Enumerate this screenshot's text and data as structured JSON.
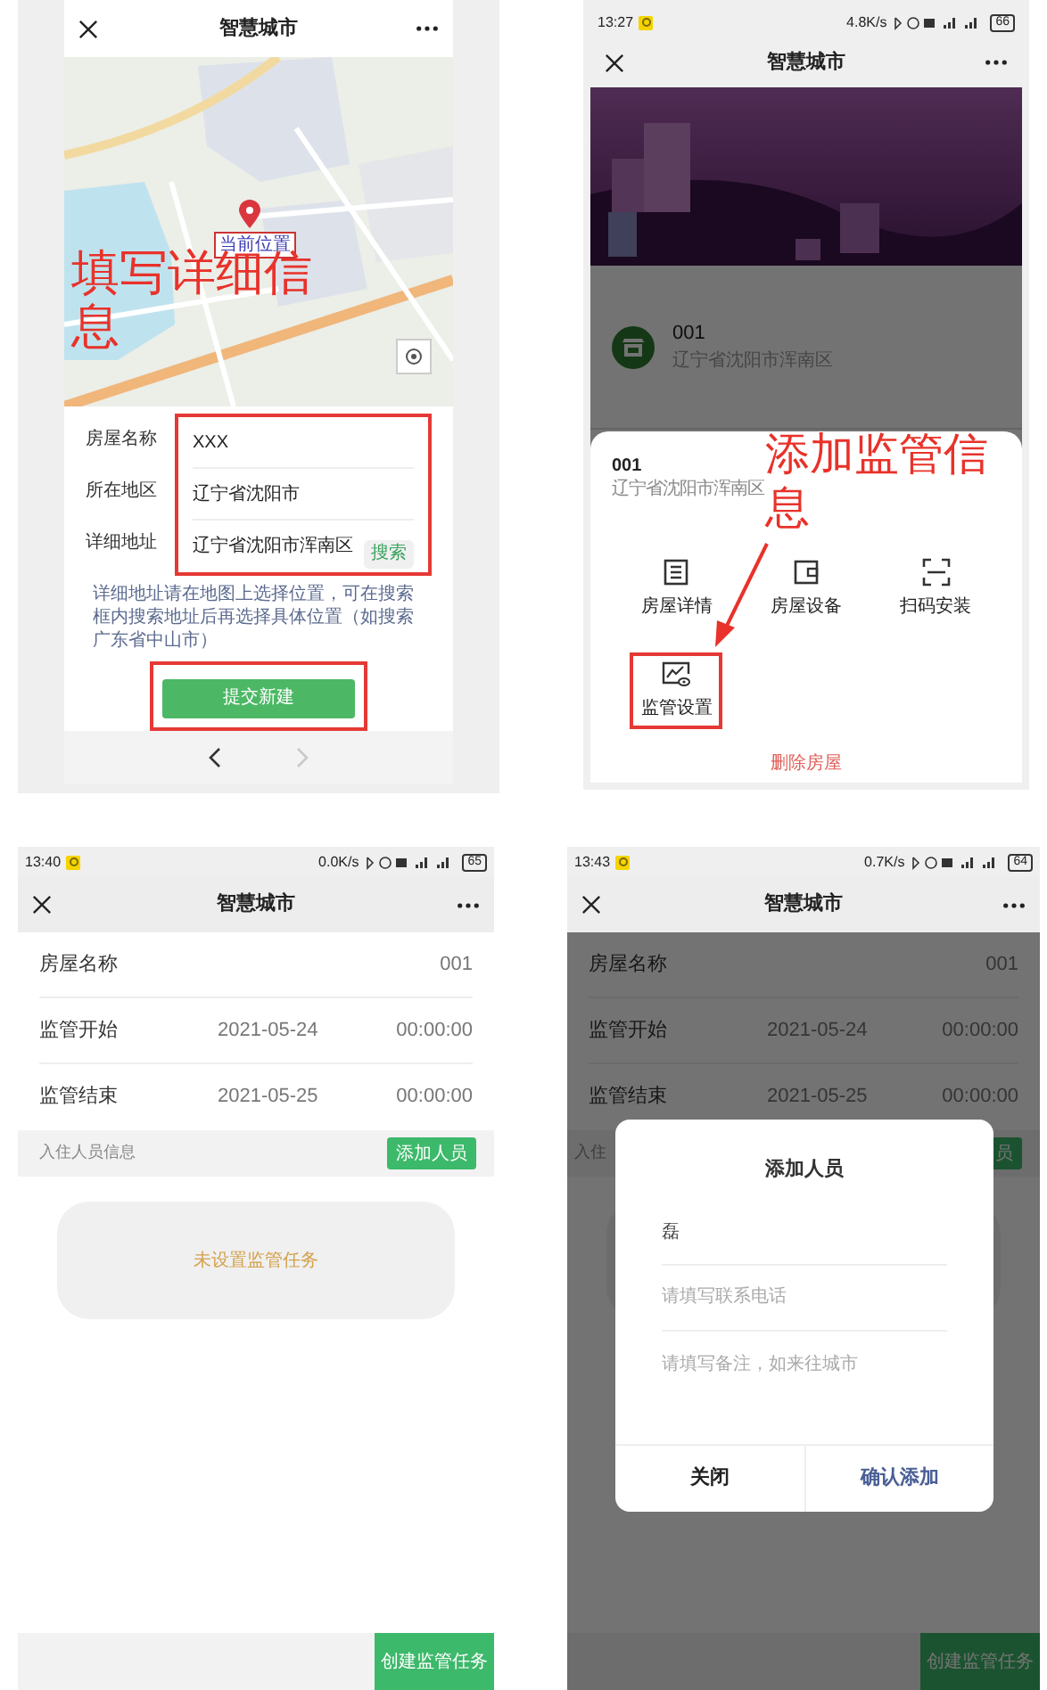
{
  "create_house": {
    "title": "智慧城市",
    "map": {
      "marker_label": "当前位置"
    },
    "annotation": "填写详细信息",
    "fields_highlighted": true,
    "fields": [
      {
        "label": "房屋名称",
        "value": "XXX"
      },
      {
        "label": "所在地区",
        "value": "辽宁省沈阳市"
      },
      {
        "label": "详细地址",
        "value": "辽宁省沈阳市浑南区",
        "action": "搜索"
      }
    ],
    "hint": "详细地址请在地图上选择位置，可在搜索框内搜索地址后再选择具体位置（如搜索广东省中山市）",
    "submit": {
      "label": "提交新建",
      "highlighted": true
    },
    "browser_nav": [
      {
        "kind": "back",
        "disabled": false
      },
      {
        "kind": "forward",
        "disabled": true
      }
    ]
  },
  "house_menu": {
    "status": {
      "time": "13:27",
      "speed": "4.8K/s",
      "battery": "66"
    },
    "title": "智慧城市",
    "house": {
      "name": "001",
      "address": "辽宁省沈阳市浑南区"
    },
    "sheet": {
      "name": "001",
      "address": "辽宁省沈阳市浑南区",
      "actions": [
        {
          "kind": "list",
          "label": "房屋详情",
          "highlighted": false
        },
        {
          "kind": "device",
          "label": "房屋设备",
          "highlighted": false
        },
        {
          "kind": "scan",
          "label": "扫码安装",
          "highlighted": false
        },
        {
          "kind": "monitor",
          "label": "监管设置",
          "highlighted": true
        }
      ],
      "delete": "删除房屋"
    },
    "annotation": "添加监管信息"
  },
  "supervision": {
    "status": {
      "time": "13:40",
      "speed": "0.0K/s",
      "battery": "65"
    },
    "title": "智慧城市",
    "rows": [
      {
        "label": "房屋名称",
        "value": "001"
      },
      {
        "label": "监管开始",
        "date": "2021-05-24",
        "time": "00:00:00"
      },
      {
        "label": "监管结束",
        "date": "2021-05-25",
        "time": "00:00:00"
      }
    ],
    "residents": {
      "label": "入住人员信息",
      "button": "添加人员"
    },
    "empty": "未设置监管任务",
    "create_button": "创建监管任务"
  },
  "add_person": {
    "status": {
      "time": "13:43",
      "speed": "0.7K/s",
      "battery": "64"
    },
    "title": "智慧城市",
    "rows": [
      {
        "label": "房屋名称",
        "value": "001"
      },
      {
        "label": "监管开始",
        "date": "2021-05-24",
        "time": "00:00:00"
      },
      {
        "label": "监管结束",
        "date": "2021-05-25",
        "time": "00:00:00"
      }
    ],
    "residents": {
      "label": "入住",
      "button": "员"
    },
    "create_button": "创建监管任务",
    "dialog": {
      "title": "添加人员",
      "fields": [
        {
          "value": "磊"
        },
        {
          "placeholder": "请填写联系电话"
        },
        {
          "placeholder": "请填写备注，如来往城市"
        }
      ],
      "buttons": [
        {
          "kind": "cancel",
          "label": "关闭"
        },
        {
          "kind": "confirm",
          "label": "确认添加"
        }
      ]
    }
  }
}
